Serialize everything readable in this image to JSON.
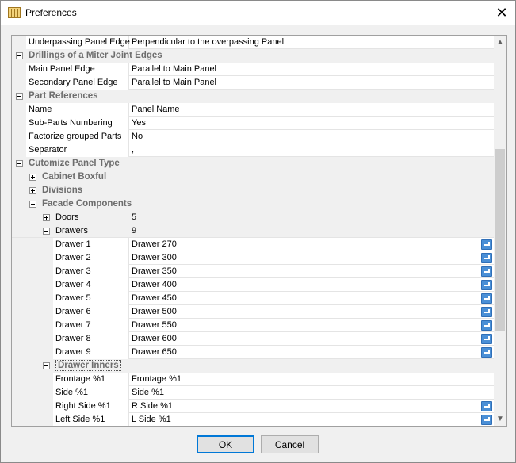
{
  "window": {
    "title": "Preferences"
  },
  "scrollbar": {
    "position": 0.55,
    "visible_fraction": 0.5
  },
  "rows": [
    {
      "kind": "prop",
      "indent": 0,
      "label": "Underpassing Panel Edge",
      "value": "Perpendicular to the overpassing Panel"
    },
    {
      "kind": "cat",
      "indent": 0,
      "label": "Drillings of a Miter Joint Edges",
      "expanded": true
    },
    {
      "kind": "prop",
      "indent": 0,
      "label": "Main Panel Edge",
      "value": "Parallel to Main Panel"
    },
    {
      "kind": "prop",
      "indent": 0,
      "label": "Secondary Panel Edge",
      "value": "Parallel to Main Panel"
    },
    {
      "kind": "cat",
      "indent": 0,
      "label": "Part References",
      "expanded": true
    },
    {
      "kind": "prop",
      "indent": 0,
      "label": "Name",
      "value": "Panel Name"
    },
    {
      "kind": "prop",
      "indent": 0,
      "label": "Sub-Parts Numbering",
      "value": "Yes"
    },
    {
      "kind": "prop",
      "indent": 0,
      "label": "Factorize grouped Parts",
      "value": "No"
    },
    {
      "kind": "prop",
      "indent": 0,
      "label": "Separator",
      "value": ","
    },
    {
      "kind": "cat",
      "indent": 0,
      "label": "Cutomize Panel Type",
      "expanded": true
    },
    {
      "kind": "cat",
      "indent": 1,
      "label": "Cabinet Boxful",
      "expanded": false
    },
    {
      "kind": "cat",
      "indent": 1,
      "label": "Divisions",
      "expanded": false
    },
    {
      "kind": "cat",
      "indent": 1,
      "label": "Facade Components",
      "expanded": true
    },
    {
      "kind": "sub",
      "indent": 2,
      "label": "Doors",
      "value": "5",
      "expanded": false
    },
    {
      "kind": "sub",
      "indent": 2,
      "label": "Drawers",
      "value": "9",
      "expanded": true
    },
    {
      "kind": "prop",
      "indent": 2,
      "label": "Drawer 1",
      "value": "Drawer 270",
      "reset": true
    },
    {
      "kind": "prop",
      "indent": 2,
      "label": "Drawer 2",
      "value": "Drawer 300",
      "reset": true
    },
    {
      "kind": "prop",
      "indent": 2,
      "label": "Drawer 3",
      "value": "Drawer 350",
      "reset": true
    },
    {
      "kind": "prop",
      "indent": 2,
      "label": "Drawer 4",
      "value": "Drawer 400",
      "reset": true
    },
    {
      "kind": "prop",
      "indent": 2,
      "label": "Drawer 5",
      "value": "Drawer 450",
      "reset": true
    },
    {
      "kind": "prop",
      "indent": 2,
      "label": "Drawer 6",
      "value": "Drawer 500",
      "reset": true
    },
    {
      "kind": "prop",
      "indent": 2,
      "label": "Drawer 7",
      "value": "Drawer 550",
      "reset": true
    },
    {
      "kind": "prop",
      "indent": 2,
      "label": "Drawer 8",
      "value": "Drawer 600",
      "reset": true
    },
    {
      "kind": "prop",
      "indent": 2,
      "label": "Drawer 9",
      "value": "Drawer 650",
      "reset": true
    },
    {
      "kind": "subcat",
      "indent": 2,
      "label": "Drawer Inners",
      "expanded": true,
      "focused": true
    },
    {
      "kind": "prop",
      "indent": 2,
      "label": "Frontage %1",
      "value": "Frontage %1"
    },
    {
      "kind": "prop",
      "indent": 2,
      "label": "Side %1",
      "value": "Side %1"
    },
    {
      "kind": "prop",
      "indent": 2,
      "label": "Right Side %1",
      "value": "R Side %1",
      "reset": true
    },
    {
      "kind": "prop",
      "indent": 2,
      "label": "Left Side %1",
      "value": "L Side %1",
      "reset": true
    }
  ],
  "buttons": {
    "ok": "OK",
    "cancel": "Cancel"
  },
  "icons": {
    "close": "close-icon",
    "app": "preferences-icon"
  }
}
